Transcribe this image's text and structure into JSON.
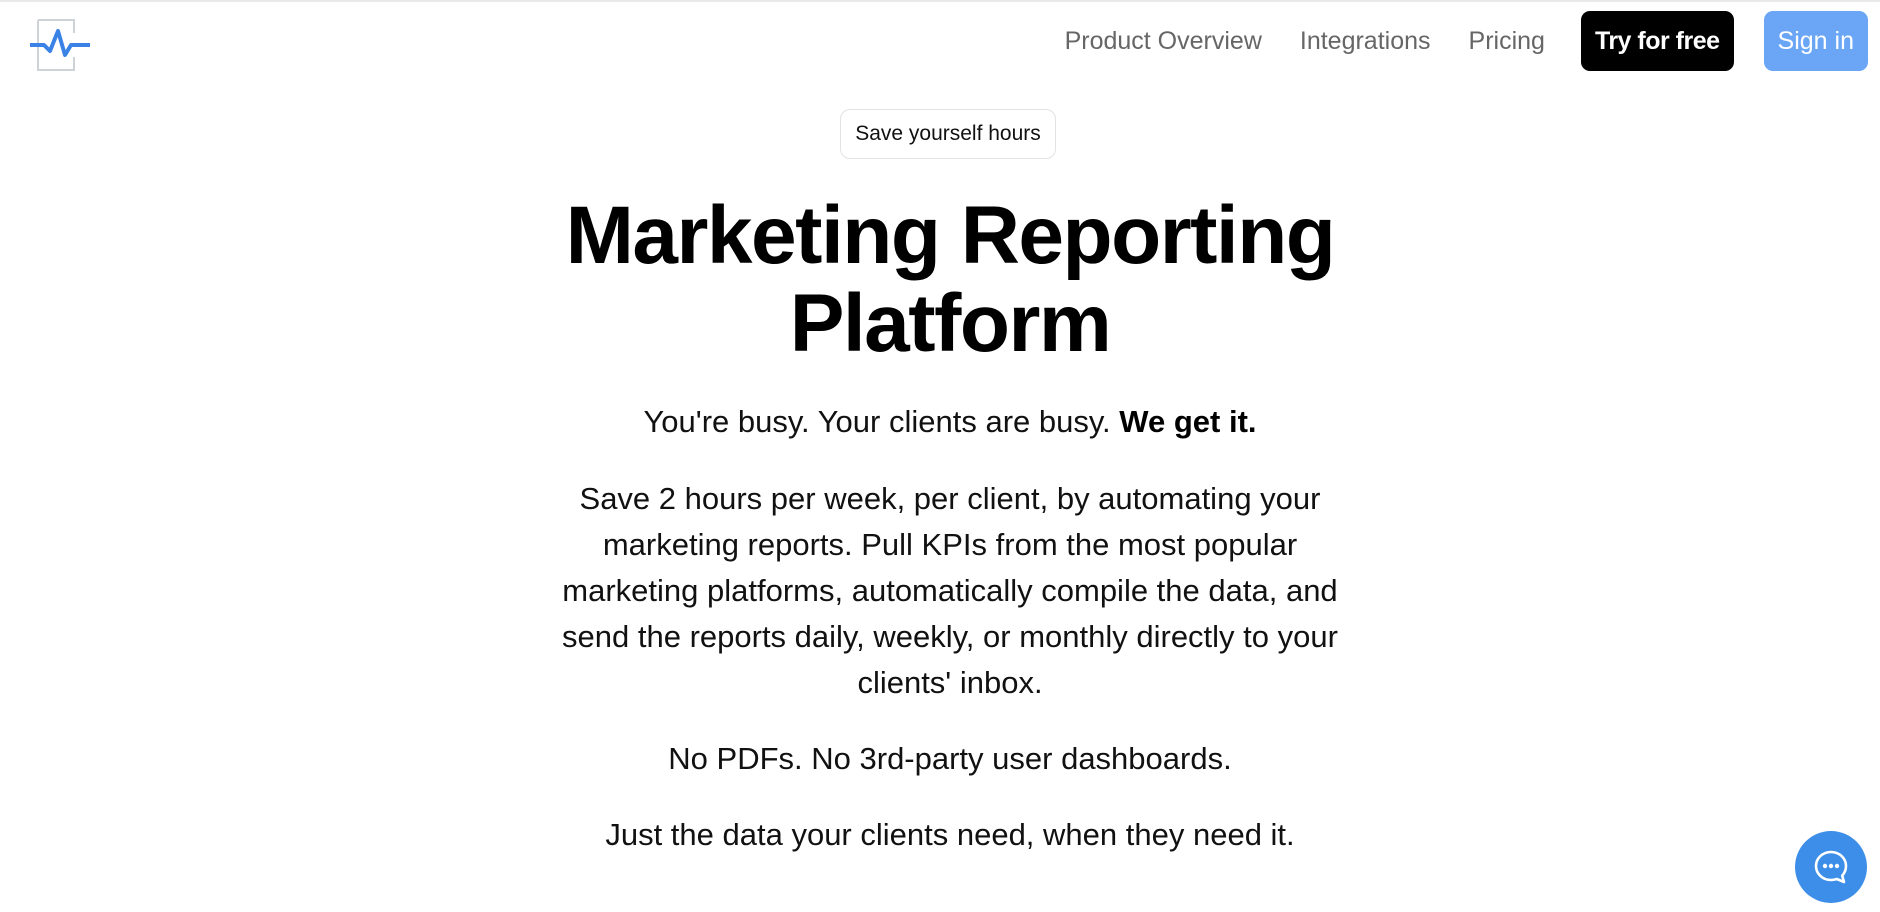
{
  "nav": {
    "logo": "pulse-logo-icon",
    "links": [
      "Product Overview",
      "Integrations",
      "Pricing"
    ],
    "try_label": "Try for free",
    "signin_label": "Sign in"
  },
  "hero": {
    "badge": "Save yourself hours",
    "headline_line1": "Marketing Reporting",
    "headline_line2": "Platform",
    "tagline_plain": "You're busy. Your clients are busy.",
    "tagline_bold": "We get it.",
    "description_lines": [
      "Save 2 hours per week, per client, by automating your",
      "marketing reports. Pull KPIs from the most popular",
      "marketing platforms, automatically compile the data, and",
      "send the reports daily, weekly, or monthly directly to your",
      "clients' inbox."
    ],
    "no_pdfs": "No PDFs. No 3rd-party user dashboards.",
    "just_data": "Just the data your clients need, when they need it."
  },
  "chat": {
    "icon": "chat-bubble-icon"
  },
  "colors": {
    "accent_blue": "#6aa6f5",
    "chat_blue": "#3d8ee8",
    "logo_blue": "#3b82e6",
    "try_button_bg": "#000000"
  }
}
